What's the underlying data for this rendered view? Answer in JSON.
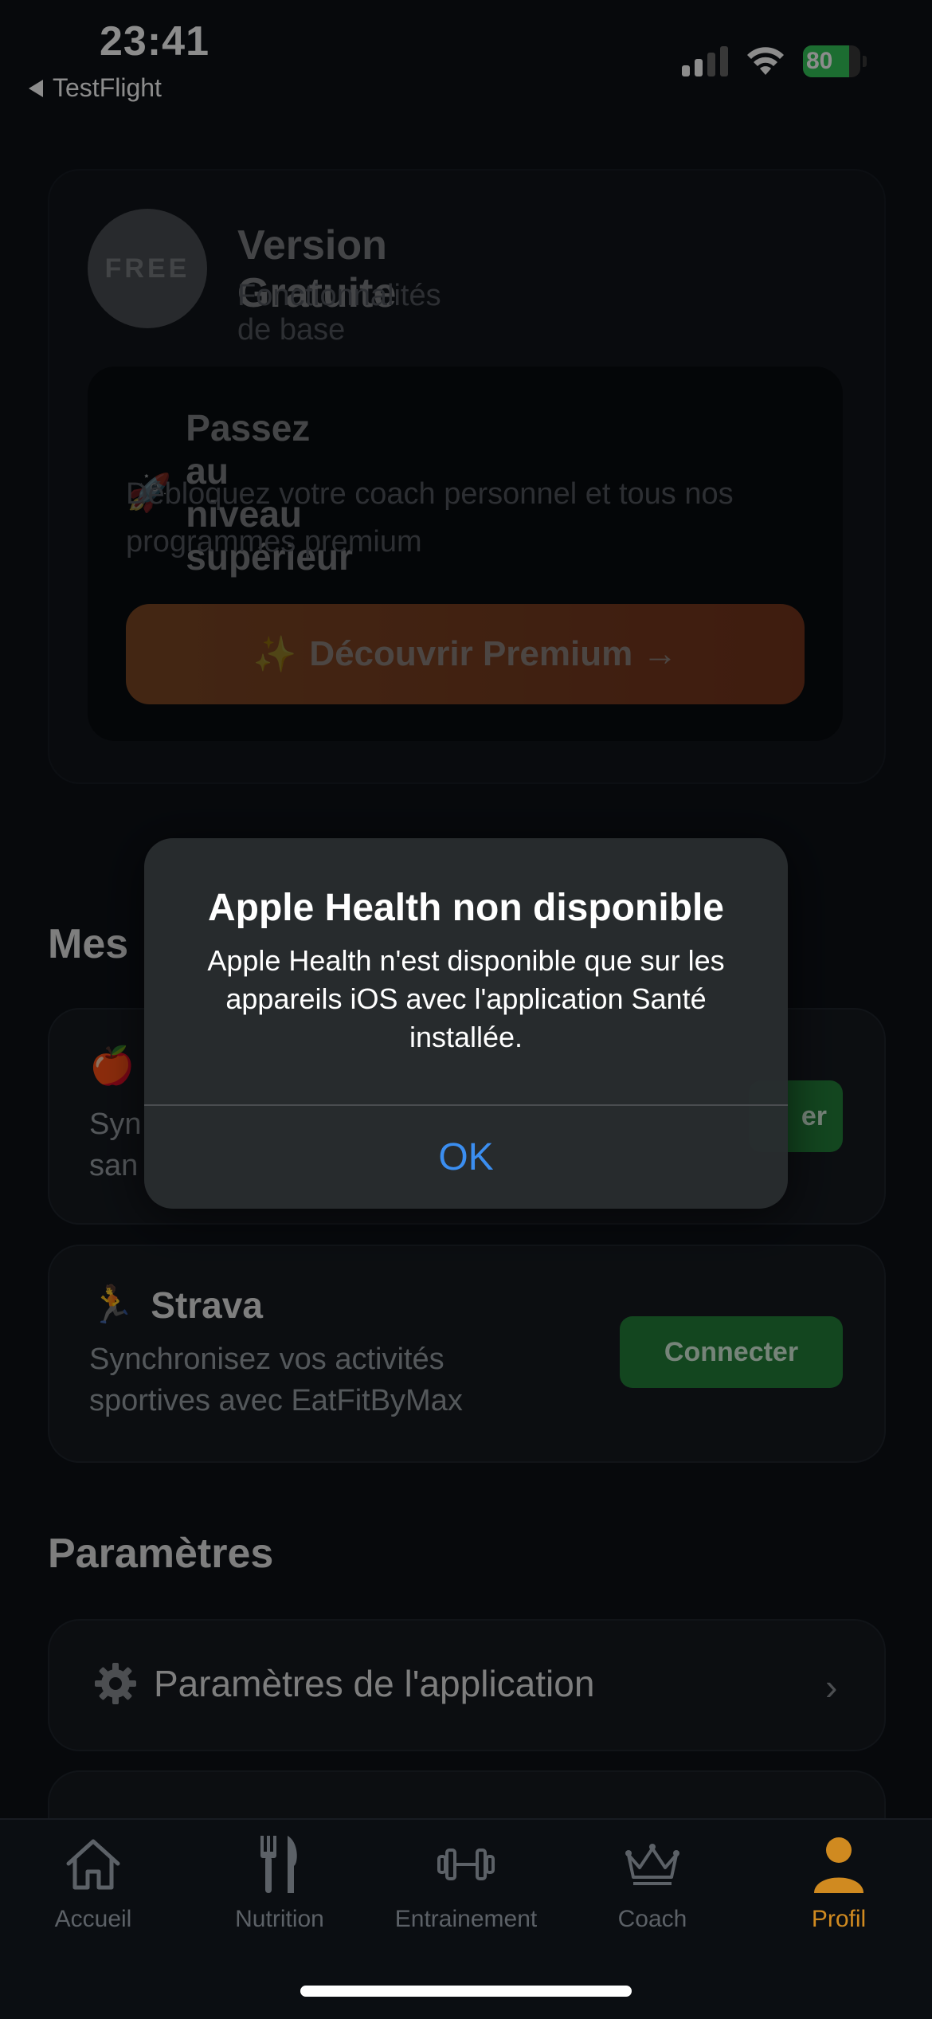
{
  "status_bar": {
    "time": "23:41",
    "back_app": "TestFlight",
    "battery": "80",
    "battery_level": 0.8
  },
  "plan": {
    "badge": "FREE",
    "title": "Version Gratuite",
    "subtitle": "Fonctionnalités de base",
    "promo_emoji": "🚀",
    "promo_title": "Passez au niveau supérieur",
    "promo_text": "Débloquez votre coach personnel et tous nos programmes premium",
    "cta_emoji": "✨",
    "cta_label": "Découvrir Premium →"
  },
  "integrations": {
    "section_title_partial": "Mes",
    "apple_health": {
      "emoji": "🍎",
      "desc_partial": "Syn san",
      "button_partial": "er"
    },
    "strava": {
      "emoji": "🏃",
      "title": "Strava",
      "desc": "Synchronisez vos activités sportives avec EatFitByMax",
      "button": "Connecter"
    }
  },
  "settings": {
    "section_title": "Paramètres",
    "app_settings": "Paramètres de l'application",
    "app_settings_icon": "gear-icon"
  },
  "alert": {
    "title": "Apple Health non disponible",
    "message": "Apple Health n'est disponible que sur les appareils iOS avec l'application Santé installée.",
    "ok": "OK"
  },
  "tabs": [
    {
      "label": "Accueil",
      "icon": "home-icon"
    },
    {
      "label": "Nutrition",
      "icon": "fork-knife-icon"
    },
    {
      "label": "Entrainement",
      "icon": "dumbbell-icon"
    },
    {
      "label": "Coach",
      "icon": "crown-icon"
    },
    {
      "label": "Profil",
      "icon": "person-icon"
    }
  ],
  "colors": {
    "accent": "#d08a20",
    "alert_button": "#3b8ef0",
    "connect_green": "#23803a",
    "cta_gradient": [
      "#d2702c",
      "#c64f1f"
    ]
  }
}
